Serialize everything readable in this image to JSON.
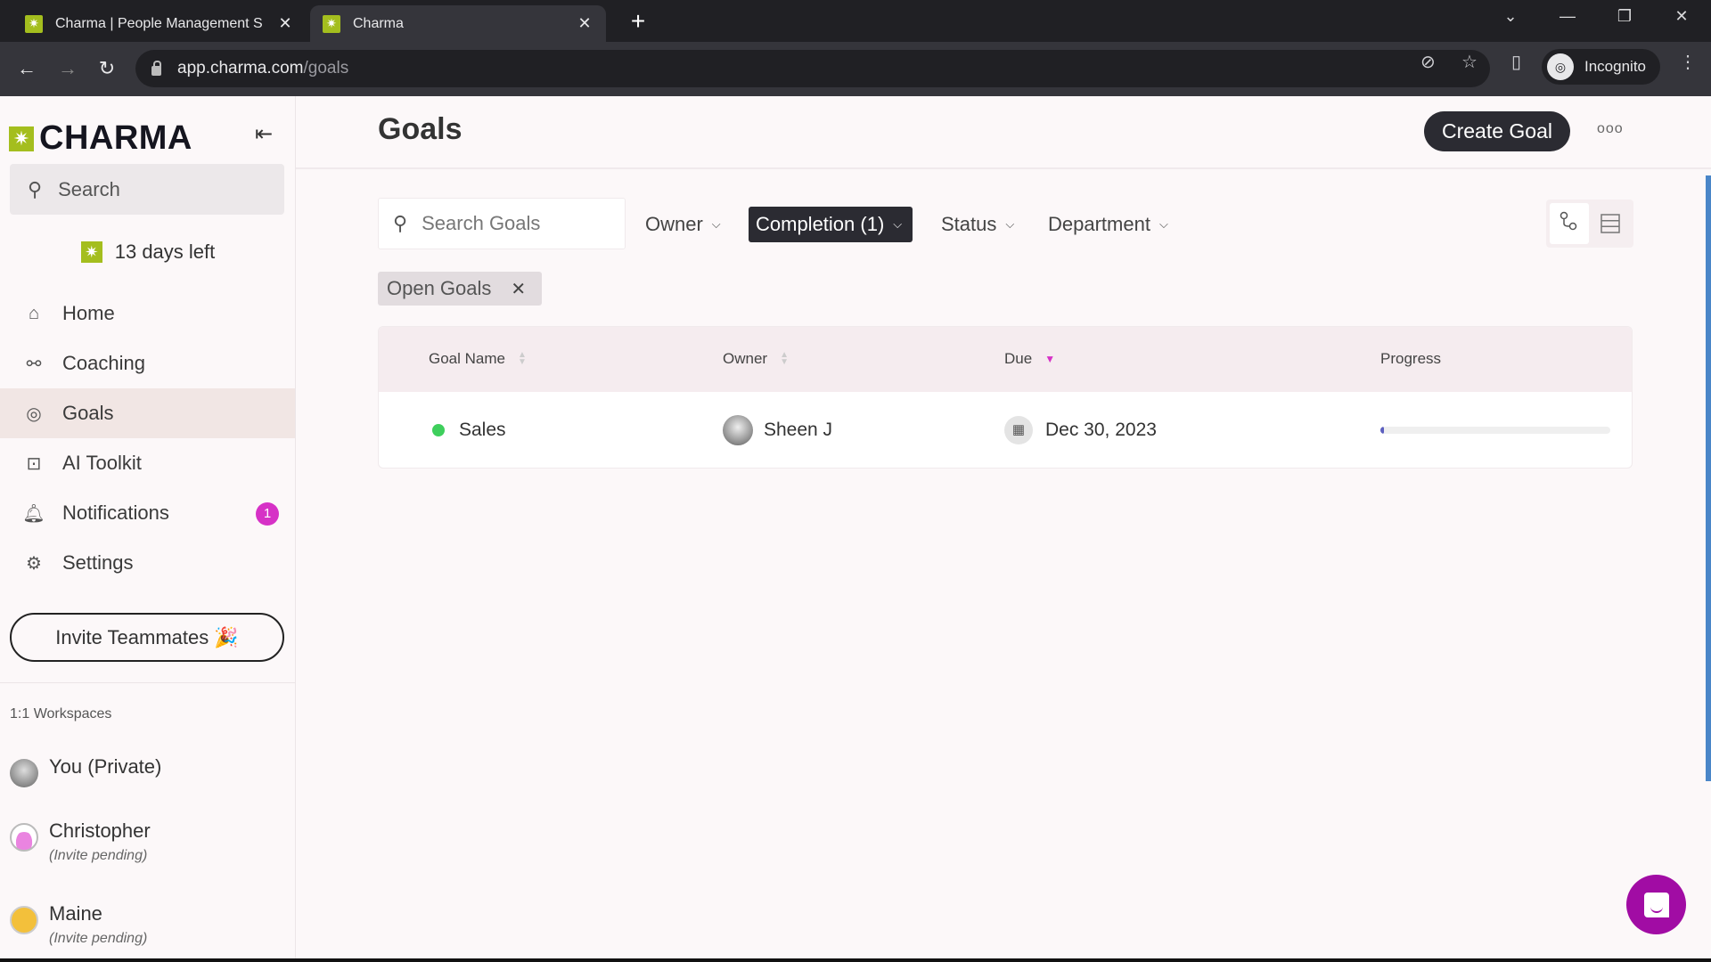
{
  "browser": {
    "tabs": [
      {
        "title": "Charma | People Management S",
        "active": false
      },
      {
        "title": "Charma",
        "active": true
      }
    ],
    "url_host": "app.charma.com",
    "url_path": "/goals",
    "profile_label": "Incognito",
    "icons": {
      "back": "←",
      "forward": "→",
      "reload": "↻",
      "new_tab": "+",
      "tab_close": "✕",
      "tab_list": "⌄",
      "minimize": "—",
      "restore": "❐",
      "close": "✕",
      "eye_off": "⊘",
      "star": "☆",
      "sidepanel": "▯",
      "menu": "⋮",
      "incognito": "◎"
    }
  },
  "sidebar": {
    "brand": "CHARMA",
    "brand_mark": "✷",
    "collapse_icon": "⇤",
    "search_placeholder": "Search",
    "search_icon": "⚲",
    "trial_text": "13 days left",
    "nav": [
      {
        "label": "Home",
        "icon": "⌂",
        "active": false
      },
      {
        "label": "Coaching",
        "icon": "⚯",
        "active": false
      },
      {
        "label": "Goals",
        "icon": "◎",
        "active": true
      },
      {
        "label": "AI Toolkit",
        "icon": "⊡",
        "active": false
      },
      {
        "label": "Notifications",
        "icon": "♫",
        "active": false,
        "badge": "1"
      },
      {
        "label": "Settings",
        "icon": "⚙",
        "active": false
      }
    ],
    "invite_label": "Invite Teammates 🎉",
    "workspaces_title": "1:1 Workspaces",
    "workspaces": [
      {
        "name": "You (Private)",
        "sub": ""
      },
      {
        "name": "Christopher",
        "sub": "(Invite pending)"
      },
      {
        "name": "Maine",
        "sub": "(Invite pending)"
      }
    ]
  },
  "main": {
    "title": "Goals",
    "create_label": "Create Goal",
    "more_label": "ooo",
    "search_placeholder": "Search Goals",
    "filters": [
      {
        "label": "Owner",
        "active": false
      },
      {
        "label": "Completion (1)",
        "active": true
      },
      {
        "label": "Status",
        "active": false
      },
      {
        "label": "Department",
        "active": false
      }
    ],
    "chevron": "⌄",
    "view_icons": {
      "tree": "⚭",
      "list": "☰"
    },
    "active_chip": "Open Goals",
    "chip_close": "✕",
    "table": {
      "columns": [
        "Goal Name",
        "Owner",
        "Due",
        "Progress"
      ],
      "sorted_column": "Due",
      "rows": [
        {
          "name": "Sales",
          "status_color": "#3ecf5c",
          "owner": "Sheen J",
          "due": "Dec 30, 2023",
          "progress": 0.01
        }
      ]
    }
  },
  "colors": {
    "accent": "#d631c6",
    "brand_green": "#a4be1e",
    "chat": "#a10ca4"
  }
}
